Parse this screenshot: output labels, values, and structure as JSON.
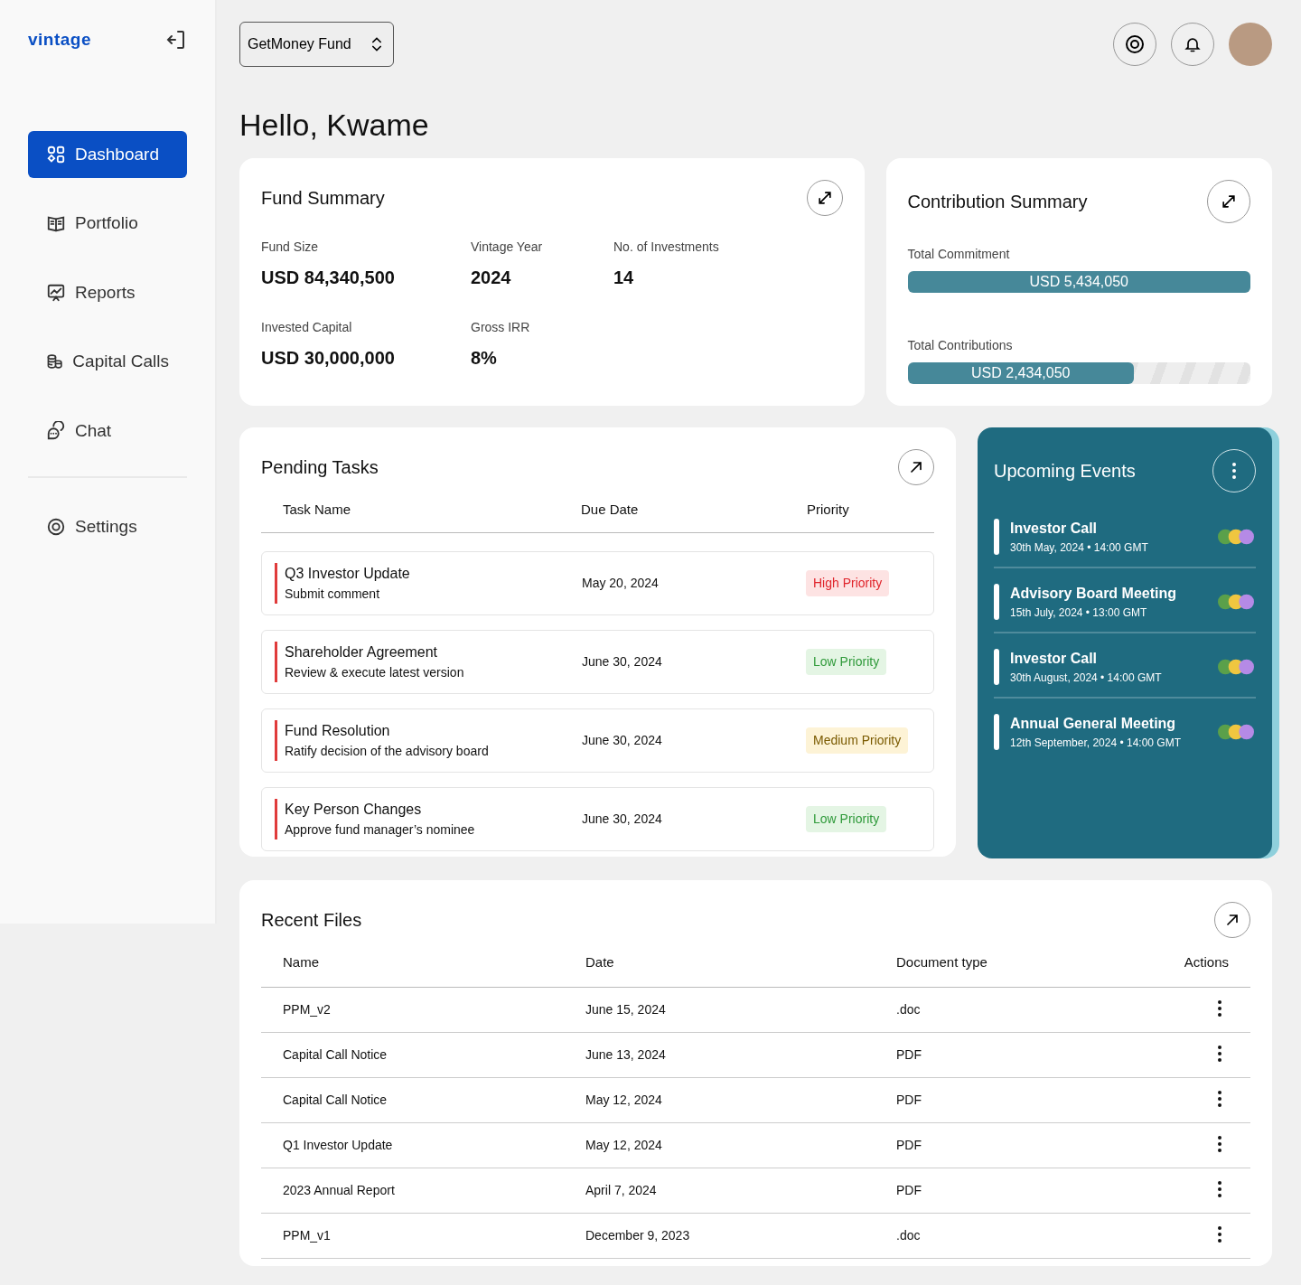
{
  "brand": {
    "logo": "vintage"
  },
  "sidebar": {
    "items": [
      {
        "label": "Dashboard",
        "selected": true
      },
      {
        "label": "Portfolio",
        "selected": false
      },
      {
        "label": "Reports",
        "selected": false
      },
      {
        "label": "Capital Calls",
        "selected": false
      },
      {
        "label": "Chat",
        "selected": false
      }
    ],
    "bottom_items": [
      {
        "label": "Settings",
        "selected": false
      }
    ]
  },
  "header": {
    "fund_selector": "GetMoney Fund"
  },
  "greeting": "Hello, Kwame",
  "fund_summary": {
    "title": "Fund Summary",
    "stats": [
      {
        "label": "Fund Size",
        "value": "USD 84,340,500"
      },
      {
        "label": "Vintage Year",
        "value": "2024"
      },
      {
        "label": "No. of Investments",
        "value": "14"
      },
      {
        "label": "Invested Capital",
        "value": "USD 30,000,000"
      },
      {
        "label": "Gross IRR",
        "value": "8%"
      }
    ]
  },
  "contribution_summary": {
    "title": "Contribution Summary",
    "bars": [
      {
        "label": "Total Commitment",
        "reading": "USD 5,434,050",
        "level": 1
      },
      {
        "label": "Total Contributions",
        "reading": "USD 2,434,050",
        "level": 0.66
      }
    ]
  },
  "pending_tasks": {
    "title": "Pending Tasks",
    "columns": [
      "Task Name",
      "Due Date",
      "Priority"
    ],
    "rows": [
      {
        "name": "Q3 Investor Update",
        "detail": "Submit comment",
        "due": "May 20, 2024",
        "priority": "High Priority",
        "kind": "high"
      },
      {
        "name": "Shareholder Agreement",
        "detail": "Review & execute latest version",
        "due": "June 30, 2024",
        "priority": "Low Priority",
        "kind": "low"
      },
      {
        "name": "Fund Resolution",
        "detail": "Ratify decision of the advisory board",
        "due": "June 30, 2024",
        "priority": "Medium Priority",
        "kind": "medium"
      },
      {
        "name": "Key Person Changes",
        "detail": "Approve fund manager’s nominee",
        "due": "June 30, 2024",
        "priority": "Low Priority",
        "kind": "low"
      }
    ]
  },
  "upcoming_events": {
    "title": "Upcoming Events",
    "events": [
      {
        "title": "Investor Call",
        "when": "30th May, 2024 • 14:00 GMT"
      },
      {
        "title": "Advisory Board Meeting",
        "when": "15th July, 2024 • 13:00 GMT"
      },
      {
        "title": "Investor Call",
        "when": "30th August, 2024 • 14:00 GMT"
      },
      {
        "title": "Annual General Meeting",
        "when": "12th September, 2024 • 14:00 GMT"
      }
    ]
  },
  "recent_files": {
    "title": "Recent Files",
    "columns": [
      "Name",
      "Date",
      "Document type",
      "Actions"
    ],
    "rows": [
      {
        "name": "PPM_v2",
        "date": "June 15, 2024",
        "type": ".doc"
      },
      {
        "name": "Capital Call Notice",
        "date": "June 13, 2024",
        "type": "PDF"
      },
      {
        "name": "Capital Call Notice",
        "date": "May 12, 2024",
        "type": "PDF"
      },
      {
        "name": "Q1 Investor Update",
        "date": "May 12, 2024",
        "type": "PDF"
      },
      {
        "name": "2023 Annual Report",
        "date": "April 7, 2024",
        "type": "PDF"
      },
      {
        "name": "PPM_v1",
        "date": "December 9, 2023",
        "type": ".doc"
      }
    ]
  }
}
